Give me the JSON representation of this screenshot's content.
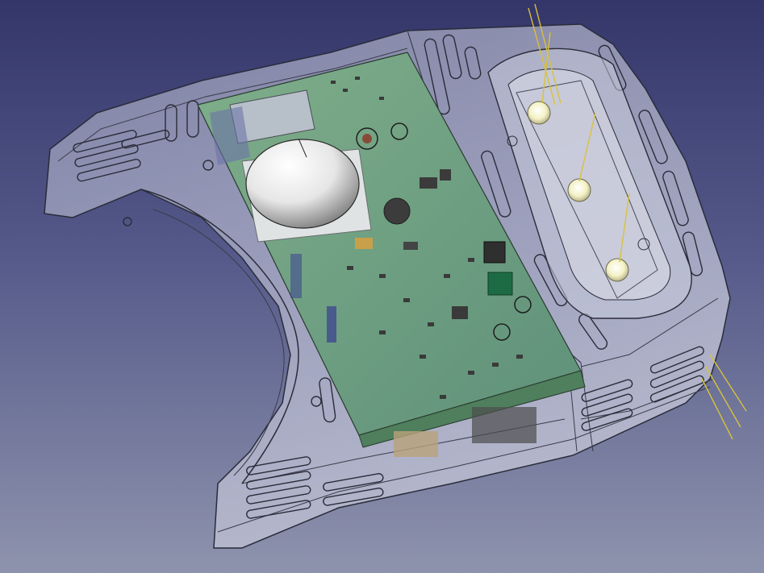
{
  "viewport": {
    "background_top": "#34366a",
    "background_bottom": "#8e93ad"
  },
  "model": {
    "housing_color": "#c9ccdd",
    "housing_edge_color": "#2a2c3a",
    "pcb_color": "#6fa07c",
    "pcb_dark_color": "#4f7f5c",
    "dome_color": "#ffffff",
    "led_color": "#f4f2c6",
    "wire_color": "#d8c23a",
    "led_count": 3
  }
}
